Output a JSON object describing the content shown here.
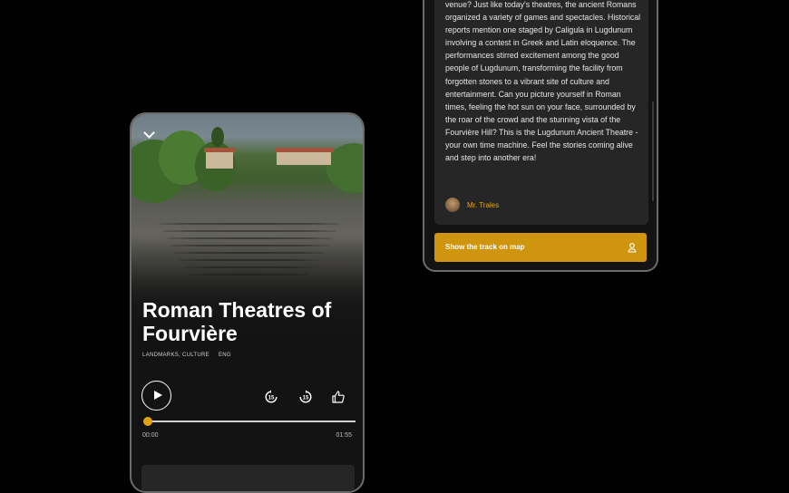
{
  "player": {
    "title": "Roman Theatres of Fourvière",
    "tags": [
      "LANDMARKS, CULTURE",
      "ENG"
    ],
    "time_current": "00:00",
    "time_total": "01:55",
    "progress": 0.0,
    "icons": [
      "chevron-down-icon",
      "play-icon",
      "rewind-15-icon",
      "forward-15-icon",
      "thumbs-up-icon"
    ]
  },
  "story": {
    "text": "venue? Just like today's theatres, the ancient Romans organized a variety of games and spectacles. Historical reports mention one staged by Caligula in Lugdunum involving a contest in Greek and Latin eloquence. The performances stirred excitement among the good people of Lugdunum, transforming the facility from forgotten stones to a vibrant site of culture and entertainment. Can you picture yourself in Roman times, feeling the hot sun on your face, surrounded by the roar of the crowd and the stunning vista of the Fourvière Hill? This is the Lugdunum Ancient Theatre - your own time machine. Feel the stories coming alive and step into another era!",
    "author": "Mr. Trales",
    "map_button": "Show the track on map"
  },
  "colors": {
    "accent": "#e1a40f",
    "button": "#cf950f",
    "card": "#262626",
    "background": "#000000"
  }
}
